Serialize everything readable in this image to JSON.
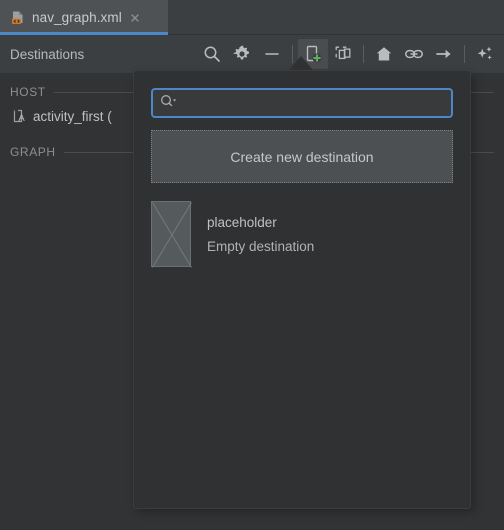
{
  "window": {
    "background_color": "#313335",
    "panel_color": "#3c3f41"
  },
  "tab": {
    "label": "nav_graph.xml",
    "icon": "xml-file-icon",
    "close_icon": "close-icon",
    "active": "true",
    "active_underline_color": "#4a88c7"
  },
  "panel": {
    "title": "Destinations"
  },
  "toolbar": {
    "items": [
      {
        "name": "search-icon",
        "tooltip": "Search"
      },
      {
        "name": "gear-icon",
        "tooltip": "Settings"
      },
      {
        "name": "minus-icon",
        "tooltip": "Zoom out"
      },
      {
        "name": "new-destination-icon",
        "tooltip": "New Destination",
        "active": "true"
      },
      {
        "name": "new-nested-graph-icon",
        "tooltip": "New Nested Graph"
      },
      {
        "name": "home-icon",
        "tooltip": "Assign start destination"
      },
      {
        "name": "link-icon",
        "tooltip": "Add deeplink"
      },
      {
        "name": "arrow-right-icon",
        "tooltip": "Add action"
      },
      {
        "name": "sparkle-icon",
        "tooltip": "Auto arrange"
      }
    ]
  },
  "sections": [
    {
      "label": "HOST",
      "rows": [
        {
          "icon": "activity-icon",
          "label": "activity_first ("
        }
      ]
    },
    {
      "label": "GRAPH",
      "rows": []
    }
  ],
  "popup": {
    "search": {
      "icon": "search-dropdown-icon",
      "value": "",
      "placeholder": ""
    },
    "create_button": {
      "label": "Create new destination"
    },
    "destinations": [
      {
        "thumbnail": "placeholder-thumbnail-icon",
        "title": "placeholder",
        "subtitle": "Empty destination"
      }
    ]
  },
  "colors": {
    "accent_blue": "#4a88c7",
    "xml_badge_orange": "#cc7832",
    "add_green": "#5fad5f",
    "text_primary": "#bfc1c2",
    "text_muted": "#8d8f90"
  }
}
